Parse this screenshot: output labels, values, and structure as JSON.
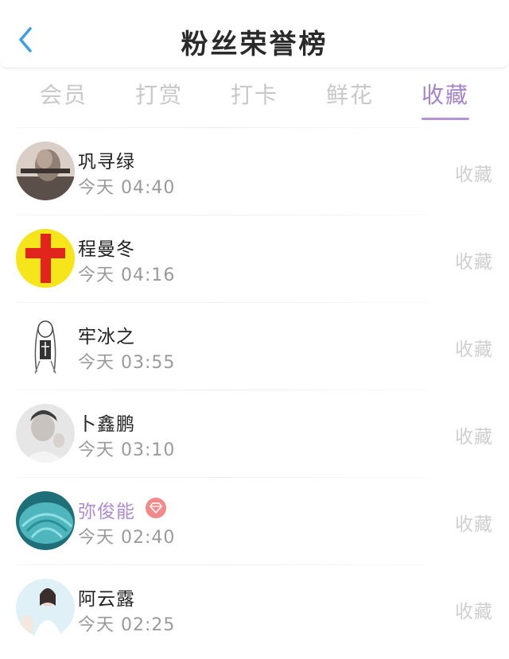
{
  "header": {
    "title": "粉丝荣誉榜",
    "back_icon": "chevron-left-icon",
    "accent": "#3aa0e8"
  },
  "tabs": [
    {
      "label": "会员",
      "active": false
    },
    {
      "label": "打赏",
      "active": false
    },
    {
      "label": "打卡",
      "active": false
    },
    {
      "label": "鲜花",
      "active": false
    },
    {
      "label": "收藏",
      "active": true
    }
  ],
  "accent_color": "#a683c9",
  "fans": [
    {
      "name": "巩寻绿",
      "time": "今天 04:40",
      "action": "收藏",
      "vip": false,
      "avatar": "sepia-photo-avatar"
    },
    {
      "name": "程曼冬",
      "time": "今天 04:16",
      "action": "收藏",
      "vip": false,
      "avatar": "red-cross-avatar"
    },
    {
      "name": "牢冰之",
      "time": "今天 03:55",
      "action": "收藏",
      "vip": false,
      "avatar": "sketch-figure-avatar"
    },
    {
      "name": "卜鑫鹏",
      "time": "今天 03:10",
      "action": "收藏",
      "vip": false,
      "avatar": "grey-portrait-avatar"
    },
    {
      "name": "弥俊能",
      "time": "今天 02:40",
      "action": "收藏",
      "vip": true,
      "avatar": "teal-shell-avatar"
    },
    {
      "name": "阿云露",
      "time": "今天 02:25",
      "action": "收藏",
      "vip": false,
      "avatar": "light-portrait-avatar"
    }
  ]
}
